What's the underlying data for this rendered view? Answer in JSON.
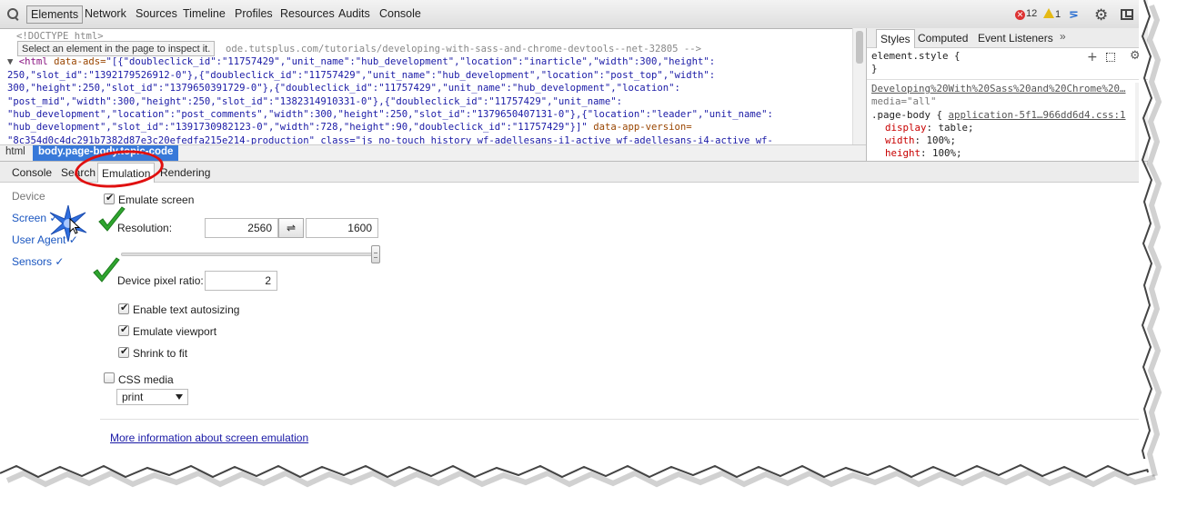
{
  "toolbar": {
    "tabs": [
      "Elements",
      "Network",
      "Sources",
      "Timeline",
      "Profiles",
      "Resources",
      "Audits",
      "Console"
    ],
    "errors": "12",
    "warnings": "1"
  },
  "dom": {
    "tooltip": "Select an element in the page to inspect it.",
    "doctype": "<!DOCTYPE html>",
    "comment_tail": "ode.tutsplus.com/tutorials/developing-with-sass-and-chrome-devtools--net-32805 -->",
    "line1_tag": "<html",
    "line1_attr": "data-ads=",
    "line1_val": "\"[{\"doubleclick_id\":\"11757429\",\"unit_name\":\"hub_development\",\"location\":\"inarticle\",\"width\":300,\"height\":",
    "line2": "250,\"slot_id\":\"1392179526912-0\"},{\"doubleclick_id\":\"11757429\",\"unit_name\":\"hub_development\",\"location\":\"post_top\",\"width\":",
    "line3": "300,\"height\":250,\"slot_id\":\"1379650391729-0\"},{\"doubleclick_id\":\"11757429\",\"unit_name\":\"hub_development\",\"location\":",
    "line4": "\"post_mid\",\"width\":300,\"height\":250,\"slot_id\":\"1382314910331-0\"},{\"doubleclick_id\":\"11757429\",\"unit_name\":",
    "line5": "\"hub_development\",\"location\":\"post_comments\",\"width\":300,\"height\":250,\"slot_id\":\"1379650407131-0\"},{\"location\":\"leader\",\"unit_name\":",
    "line6_val": "\"hub_development\",\"slot_id\":\"1391730982123-0\",\"width\":728,\"height\":90,\"doubleclick_id\":\"11757429\"}]\"",
    "line6_attr": " data-app-version=",
    "line7": "\"8c354d0c4dc291b7382d87e3c20efedfa215e214-production\" class=\"js no-touch history wf-adellesans-i1-active wf-adellesans-i4-active wf-"
  },
  "breadcrumb": {
    "html": "html",
    "body": "body.page-body.topic-code"
  },
  "styles": {
    "tabs": [
      "Styles",
      "Computed",
      "Event Listeners"
    ],
    "more": "»",
    "element_style": "element.style {",
    "close_brace": "}",
    "source": "Developing%20With%20Sass%20and%20Chrome%20…",
    "media": "media=\"all\"",
    "rule_selector": ".page-body {",
    "rule_source": "application-5f1…966dd6d4.css:1",
    "props": [
      {
        "name": "display",
        "value": "table;"
      },
      {
        "name": "width",
        "value": "100%;"
      },
      {
        "name": "height",
        "value": "100%;"
      }
    ]
  },
  "drawer": {
    "tabs": [
      "Console",
      "Search",
      "Emulation",
      "Rendering"
    ]
  },
  "emulation": {
    "sidebar": [
      {
        "label": "Device"
      },
      {
        "label": "Screen ✓"
      },
      {
        "label": "User Agent ✓"
      },
      {
        "label": "Sensors ✓"
      }
    ],
    "emulate_screen": "Emulate screen",
    "resolution_label": "Resolution:",
    "resolution_width": "2560",
    "swap": "⇌",
    "resolution_height": "1600",
    "device_pixel_ratio_label": "Device pixel ratio:",
    "device_pixel_ratio": "2",
    "enable_text_autosizing": "Enable text autosizing",
    "emulate_viewport": "Emulate viewport",
    "shrink_to_fit": "Shrink to fit",
    "css_media": "CSS media",
    "media_value": "print",
    "more_info": "More information about screen emulation"
  },
  "colors": {
    "accent_blue": "#3879d9",
    "annotation_red": "#e01010",
    "check_green": "#2fa52f"
  }
}
